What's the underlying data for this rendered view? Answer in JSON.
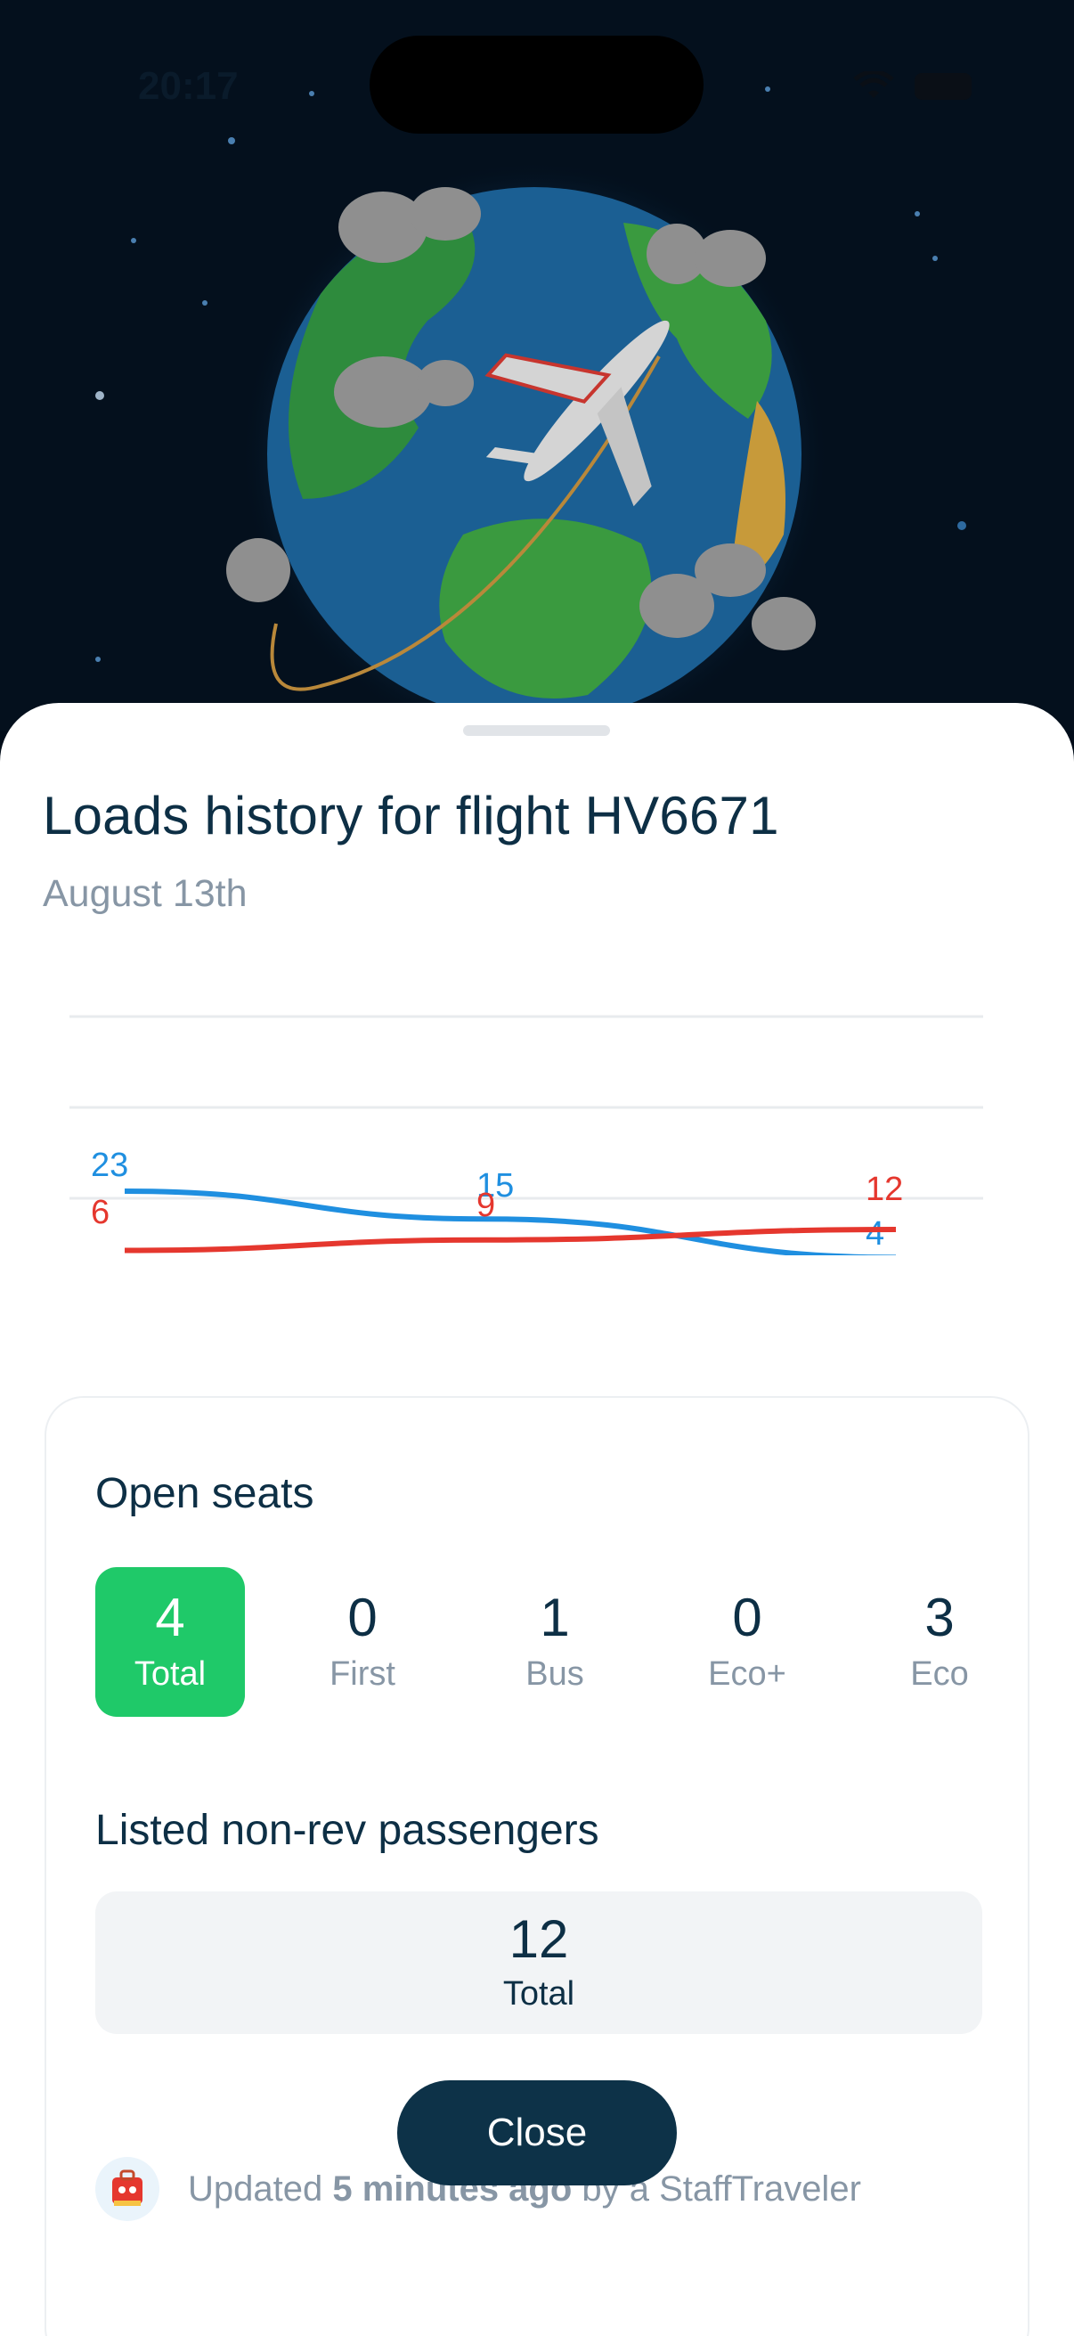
{
  "status_bar": {
    "time": "20:17"
  },
  "sheet": {
    "title": "Loads history for flight HV6671",
    "subtitle": "August 13th"
  },
  "chart_data": {
    "type": "line",
    "x": [
      0,
      1,
      2
    ],
    "series": [
      {
        "values": [
          23,
          15,
          4
        ],
        "color": "#1f8fe0"
      },
      {
        "values": [
          6,
          9,
          12
        ],
        "color": "#e5372e"
      }
    ],
    "grid": true
  },
  "open_seats": {
    "title": "Open seats",
    "items": [
      {
        "num": "4",
        "label": "Total"
      },
      {
        "num": "0",
        "label": "First"
      },
      {
        "num": "1",
        "label": "Bus"
      },
      {
        "num": "0",
        "label": "Eco+"
      },
      {
        "num": "3",
        "label": "Eco"
      }
    ]
  },
  "listed": {
    "title": "Listed non-rev passengers",
    "num": "12",
    "label": "Total"
  },
  "updated": {
    "prefix": "Updated ",
    "bold": "5 minutes ago",
    "suffix": " by a StaffTraveler"
  },
  "buttons": {
    "close": "Close"
  },
  "colors": {
    "accent_green": "#1fc969",
    "navy": "#0d3248",
    "blue": "#1f8fe0",
    "red": "#e5372e"
  }
}
